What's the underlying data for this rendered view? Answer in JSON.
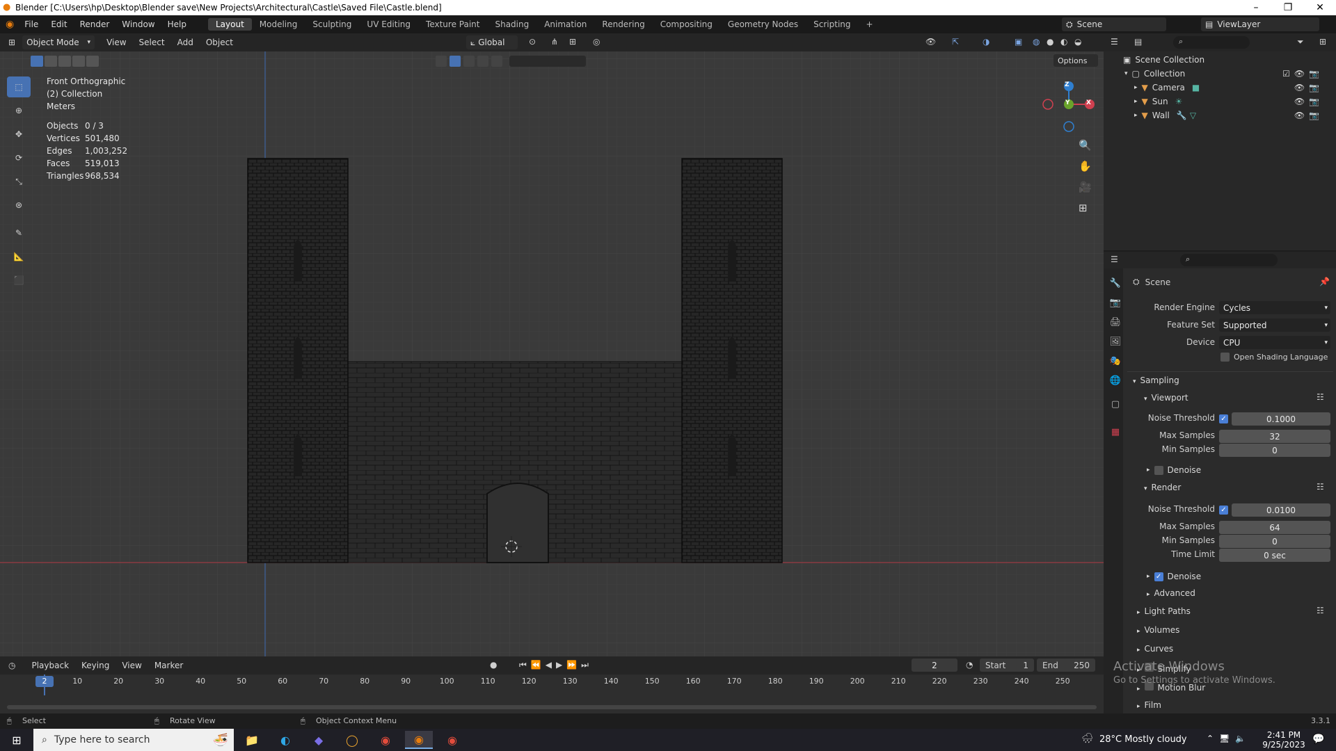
{
  "window": {
    "title": "Blender [C:\\Users\\hp\\Desktop\\Blender save\\New Projects\\Architectural\\Castle\\Saved File\\Castle.blend]"
  },
  "menu": [
    "File",
    "Edit",
    "Render",
    "Window",
    "Help"
  ],
  "workspaces": [
    "Layout",
    "Modeling",
    "Sculpting",
    "UV Editing",
    "Texture Paint",
    "Shading",
    "Animation",
    "Rendering",
    "Compositing",
    "Geometry Nodes",
    "Scripting"
  ],
  "workspace_add": "+",
  "scene_field": "Scene",
  "viewlayer_field": "ViewLayer",
  "viewport_header": {
    "mode": "Object Mode",
    "menus": [
      "View",
      "Select",
      "Add",
      "Object"
    ],
    "orientation": "Global",
    "options": "Options"
  },
  "overlay_text": {
    "view_name": "Front Orthographic",
    "collection": "(2) Collection",
    "units": "Meters",
    "stats": [
      {
        "label": "Objects",
        "value": "0 / 3"
      },
      {
        "label": "Vertices",
        "value": "501,480"
      },
      {
        "label": "Edges",
        "value": "1,003,252"
      },
      {
        "label": "Faces",
        "value": "519,013"
      },
      {
        "label": "Triangles",
        "value": "968,534"
      }
    ]
  },
  "gizmo": {
    "z": "Z",
    "y": "Y",
    "x": "X"
  },
  "outliner": {
    "root": "Scene Collection",
    "collection": "Collection",
    "items": [
      "Camera",
      "Sun",
      "Wall"
    ]
  },
  "properties": {
    "context": "Scene",
    "render_engine_label": "Render Engine",
    "render_engine": "Cycles",
    "feature_set_label": "Feature Set",
    "feature_set": "Supported",
    "device_label": "Device",
    "device": "CPU",
    "osl_label": "Open Shading Language",
    "sampling": "Sampling",
    "viewport": "Viewport",
    "noise_threshold_label": "Noise Threshold",
    "vp_noise": "0.1000",
    "max_samples_label": "Max Samples",
    "vp_max": "32",
    "min_samples_label": "Min Samples",
    "vp_min": "0",
    "denoise_label": "Denoise",
    "render": "Render",
    "r_noise": "0.0100",
    "r_max": "64",
    "r_min": "0",
    "time_limit_label": "Time Limit",
    "r_time": "0 sec",
    "advanced": "Advanced",
    "light_paths": "Light Paths",
    "volumes": "Volumes",
    "curves": "Curves",
    "simplify": "Simplify",
    "motion_blur": "Motion Blur",
    "film": "Film"
  },
  "timeline": {
    "menus": [
      "Playback",
      "Keying",
      "View",
      "Marker"
    ],
    "current_frame": "2",
    "start_label": "Start",
    "start": "1",
    "end_label": "End",
    "end": "250",
    "ticks": [
      "10",
      "20",
      "30",
      "40",
      "50",
      "60",
      "70",
      "80",
      "90",
      "100",
      "110",
      "120",
      "130",
      "140",
      "150",
      "160",
      "170",
      "180",
      "190",
      "200",
      "210",
      "220",
      "230",
      "240",
      "250"
    ],
    "playhead": "2"
  },
  "statusbar": {
    "select": "Select",
    "rotate": "Rotate View",
    "context": "Object Context Menu",
    "version": "3.3.1"
  },
  "watermark": {
    "line1": "Activate Windows",
    "line2": "Go to Settings to activate Windows."
  },
  "taskbar": {
    "search_placeholder": "Type here to search",
    "weather": "28°C  Mostly cloudy",
    "time": "2:41 PM",
    "date": "9/25/2023"
  }
}
